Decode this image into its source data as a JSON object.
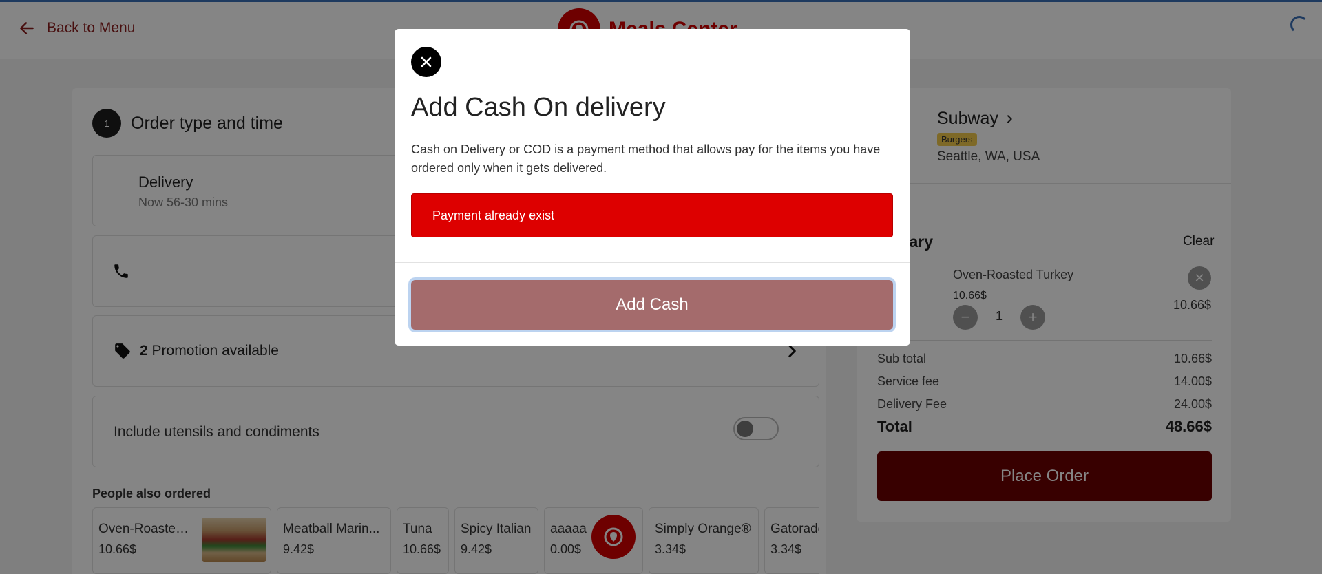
{
  "header": {
    "back_label": "Back to Menu",
    "brand_name": "Meals Center"
  },
  "order": {
    "step_number": "1",
    "step_title": "Order type and time",
    "delivery_title": "Delivery",
    "delivery_time": "Now 56-30 mins",
    "promo_count": "2",
    "promo_label": "Promotion available",
    "utensils_label": "Include utensils and condiments",
    "utensils_enabled": false
  },
  "also_ordered": {
    "title": "People also ordered",
    "items": [
      {
        "name": "Oven-Roasted ...",
        "price": "10.66$",
        "image": "sandwich-image"
      },
      {
        "name": "Meatball Marin...",
        "price": "9.42$"
      },
      {
        "name": "Tuna",
        "price": "10.66$"
      },
      {
        "name": "Spicy Italian",
        "price": "9.42$"
      },
      {
        "name": "aaaaa",
        "price": "0.00$",
        "image": "meals-center-logo"
      },
      {
        "name": "Simply Orange®",
        "price": "3.34$"
      },
      {
        "name": "Gatorade",
        "price": "3.34$"
      }
    ]
  },
  "restaurant": {
    "name": "Subway",
    "tag": "Burgers",
    "location": "Seattle, WA, USA"
  },
  "summary": {
    "colon": ":",
    "title": "mary",
    "clear_label": "Clear",
    "item": {
      "name": "Oven-Roasted Turkey",
      "unit_price": "10.66$",
      "quantity": "1",
      "line_total": "10.66$"
    },
    "rows": [
      {
        "label": "Sub total",
        "value": "10.66$"
      },
      {
        "label": "Service fee",
        "value": "14.00$"
      },
      {
        "label": "Delivery Fee",
        "value": "24.00$"
      }
    ],
    "total_label": "Total",
    "total_value": "48.66$",
    "place_order_label": "Place Order"
  },
  "modal": {
    "title": "Add Cash On delivery",
    "description": "Cash on Delivery or COD is a payment method that allows pay for the items you have ordered only when it gets delivered.",
    "alert": "Payment already exist",
    "button_label": "Add Cash"
  },
  "colors": {
    "brand": "#d40000",
    "place_order": "#6b0000",
    "alert": "#dd0000",
    "modal_button": "#a46b6c",
    "tag": "#f2c94c"
  }
}
